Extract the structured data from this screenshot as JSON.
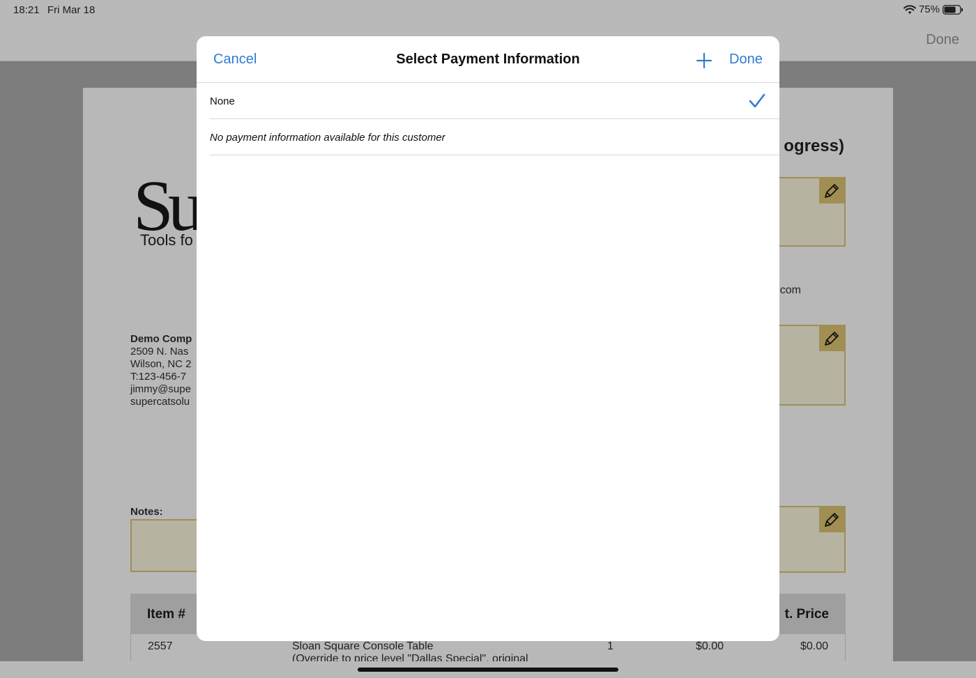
{
  "status_bar": {
    "time": "18:21",
    "date": "Fri Mar 18",
    "battery_percent": "75%",
    "battery_level": 0.75
  },
  "nav_bar": {
    "done_label": "Done"
  },
  "document": {
    "heading_fragment": "ogress)",
    "logo_letters": "Su",
    "logo_tagline_fragment": "Tools fo",
    "email_fragment": ".com",
    "company_lines": [
      "Demo Comp",
      "2509 N. Nas",
      "Wilson, NC 2",
      "T:123-456-7",
      "jimmy@supe",
      "supercatsolu"
    ],
    "notes_label": "Notes:",
    "table_header": {
      "item": "Item #",
      "price_fragment": "t. Price"
    },
    "first_row": {
      "item": "2557",
      "description": "Sloan Square Console Table",
      "description_line2": "(Override to price level \"Dallas Special\", original",
      "qty": "1",
      "unit_price": "$0.00",
      "ext_price": "$0.00"
    }
  },
  "modal": {
    "cancel_label": "Cancel",
    "title": "Select Payment Information",
    "done_label": "Done",
    "options": [
      {
        "label": "None",
        "selected": true
      }
    ],
    "empty_message": "No payment information available for this customer"
  },
  "colors": {
    "accent": "#2f7bd4",
    "dim_background": "#7d7d7d",
    "edit_box_border": "#a08e52"
  }
}
